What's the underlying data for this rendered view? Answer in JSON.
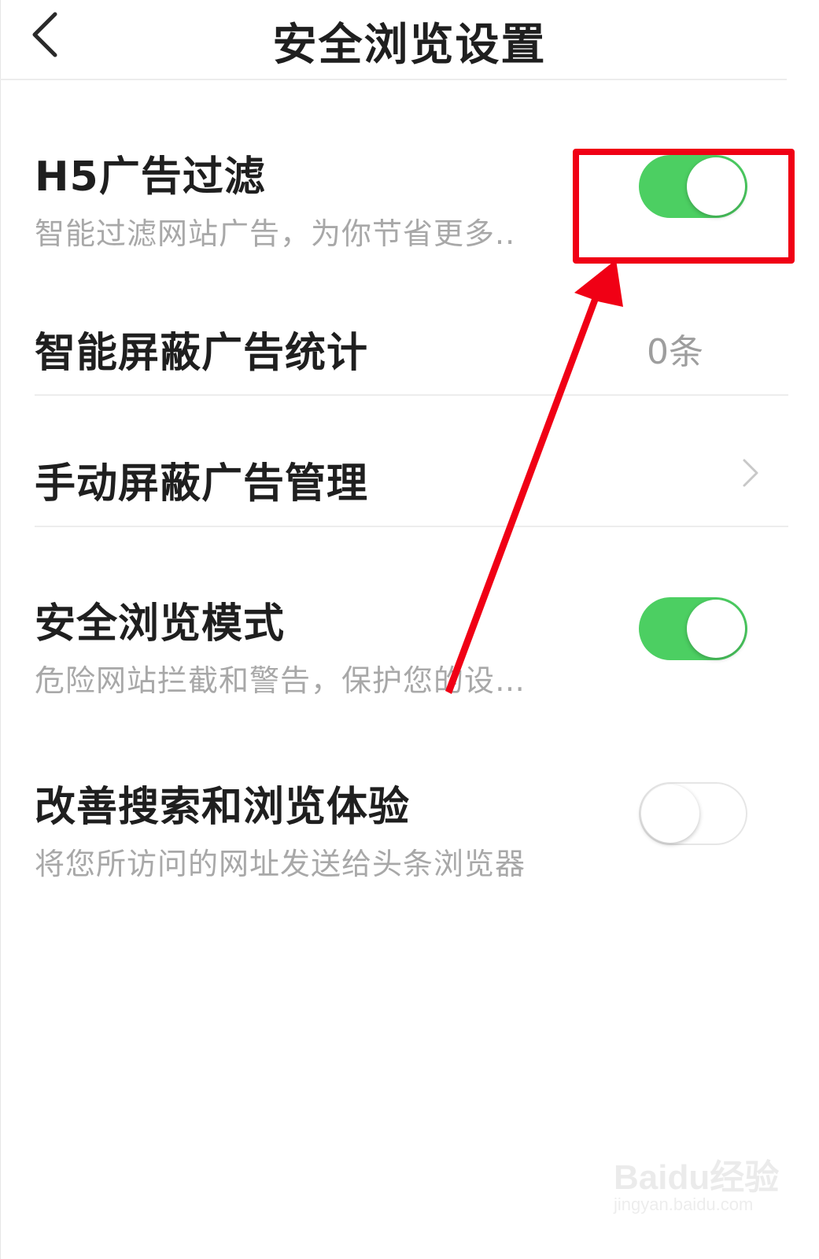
{
  "header": {
    "title": "安全浏览设置"
  },
  "settings": {
    "h5_ad_filter": {
      "title": "H5广告过滤",
      "subtitle": "智能过滤网站广告，为你节省更多..",
      "enabled": true
    },
    "smart_block_stats": {
      "title": "智能屏蔽广告统计",
      "value": "0条"
    },
    "manual_block": {
      "title": "手动屏蔽广告管理"
    },
    "safe_browsing": {
      "title": "安全浏览模式",
      "subtitle": "危险网站拦截和警告，保护您的设…",
      "enabled": true
    },
    "improve_experience": {
      "title": "改善搜索和浏览体验",
      "subtitle": "将您所访问的网址发送给头条浏览器",
      "enabled": false
    }
  },
  "annotation": {
    "color": "#f00015"
  },
  "watermark": {
    "logo": "Baidu经验",
    "url": "jingyan.baidu.com"
  },
  "colors": {
    "toggle_on": "#4ccf62",
    "title_text": "#1f1f1f",
    "subtitle_text": "#a8a8a8"
  }
}
